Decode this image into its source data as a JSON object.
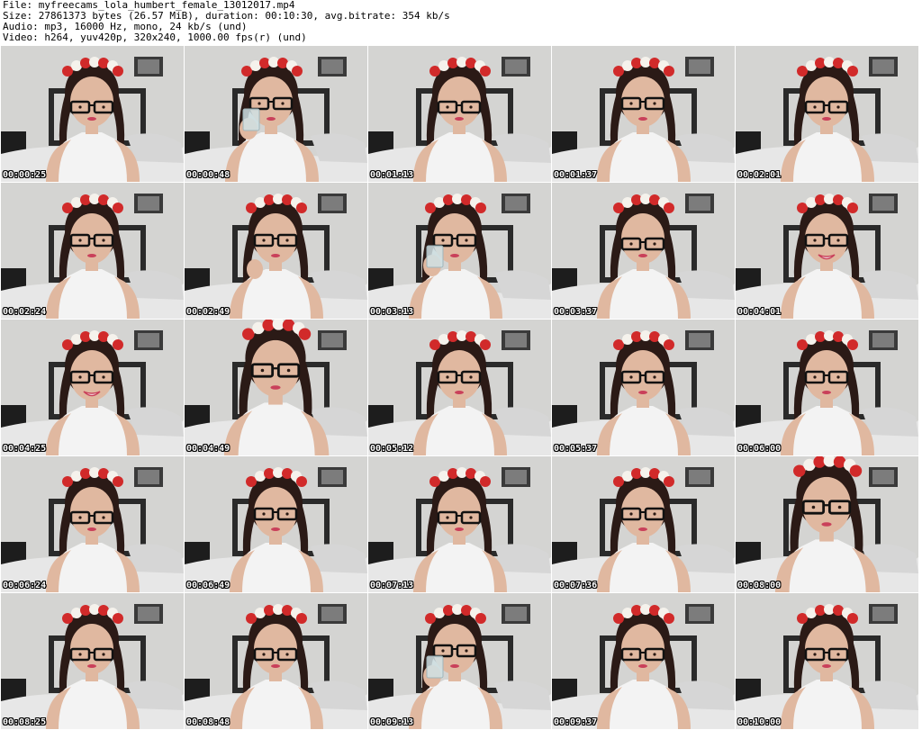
{
  "header": {
    "file_line": "File: myfreecams_lola_humbert_female_13012017.mp4",
    "size_line": "Size: 27861373 bytes (26.57 MiB), duration: 00:10:30, avg.bitrate: 354 kb/s",
    "audio_line": "Audio: mp3, 16000 Hz, mono, 24 kb/s (und)",
    "video_line": "Video: h264, yuv420p, 320x240, 1000.00 fps(r) (und)"
  },
  "frames": [
    {
      "timestamp": "00:00:25",
      "pose": "down"
    },
    {
      "timestamp": "00:00:48",
      "pose": "drink"
    },
    {
      "timestamp": "00:01:13",
      "pose": "down"
    },
    {
      "timestamp": "00:01:37",
      "pose": "front"
    },
    {
      "timestamp": "00:02:01",
      "pose": "down"
    },
    {
      "timestamp": "00:02:24",
      "pose": "front"
    },
    {
      "timestamp": "00:02:49",
      "pose": "hand"
    },
    {
      "timestamp": "00:03:13",
      "pose": "drink"
    },
    {
      "timestamp": "00:03:37",
      "pose": "down"
    },
    {
      "timestamp": "00:04:01",
      "pose": "smile"
    },
    {
      "timestamp": "00:04:25",
      "pose": "smile"
    },
    {
      "timestamp": "00:04:49",
      "pose": "close"
    },
    {
      "timestamp": "00:05:12",
      "pose": "front"
    },
    {
      "timestamp": "00:05:37",
      "pose": "front"
    },
    {
      "timestamp": "00:06:00",
      "pose": "front"
    },
    {
      "timestamp": "00:06:24",
      "pose": "down"
    },
    {
      "timestamp": "00:06:49",
      "pose": "front"
    },
    {
      "timestamp": "00:07:13",
      "pose": "down"
    },
    {
      "timestamp": "00:07:36",
      "pose": "front"
    },
    {
      "timestamp": "00:08:00",
      "pose": "close"
    },
    {
      "timestamp": "00:08:25",
      "pose": "down"
    },
    {
      "timestamp": "00:08:48",
      "pose": "down"
    },
    {
      "timestamp": "00:09:13",
      "pose": "drink"
    },
    {
      "timestamp": "00:09:37",
      "pose": "down"
    },
    {
      "timestamp": "00:10:00",
      "pose": "down"
    }
  ],
  "colors": {
    "wall": "#d4d4d2",
    "headboard": "#2a2a2a",
    "bedding": "#e7e7e7",
    "skin": "#e0b8a0",
    "hair": "#2b1a16",
    "top": "#f3f3f3",
    "flower_red": "#d12a2a",
    "flower_white": "#f5f2ec",
    "glasses": "#111111",
    "lips": "#c9405a",
    "glass_cup": "#cfe0e4"
  }
}
